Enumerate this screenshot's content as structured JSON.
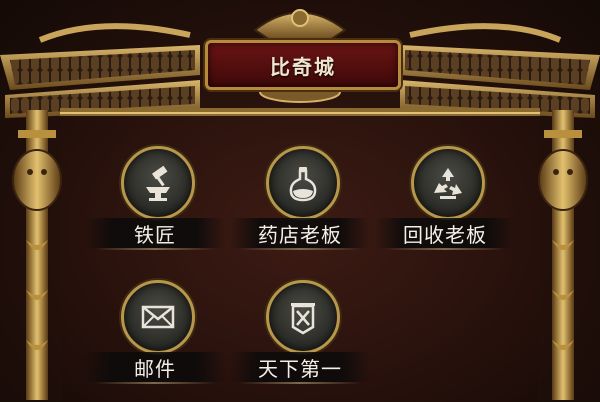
{
  "title": "比奇城",
  "npcs": [
    {
      "label": "铁匠",
      "icon": "anvil-hammer-icon"
    },
    {
      "label": "药店老板",
      "icon": "potion-flask-icon"
    },
    {
      "label": "回收老板",
      "icon": "recycle-icon"
    },
    {
      "label": "邮件",
      "icon": "envelope-icon"
    },
    {
      "label": "天下第一",
      "icon": "banner-crossed-swords-icon"
    }
  ],
  "colors": {
    "gold": "#b8964a",
    "title_red": "#6b1414",
    "bg_dark": "#24100b"
  }
}
